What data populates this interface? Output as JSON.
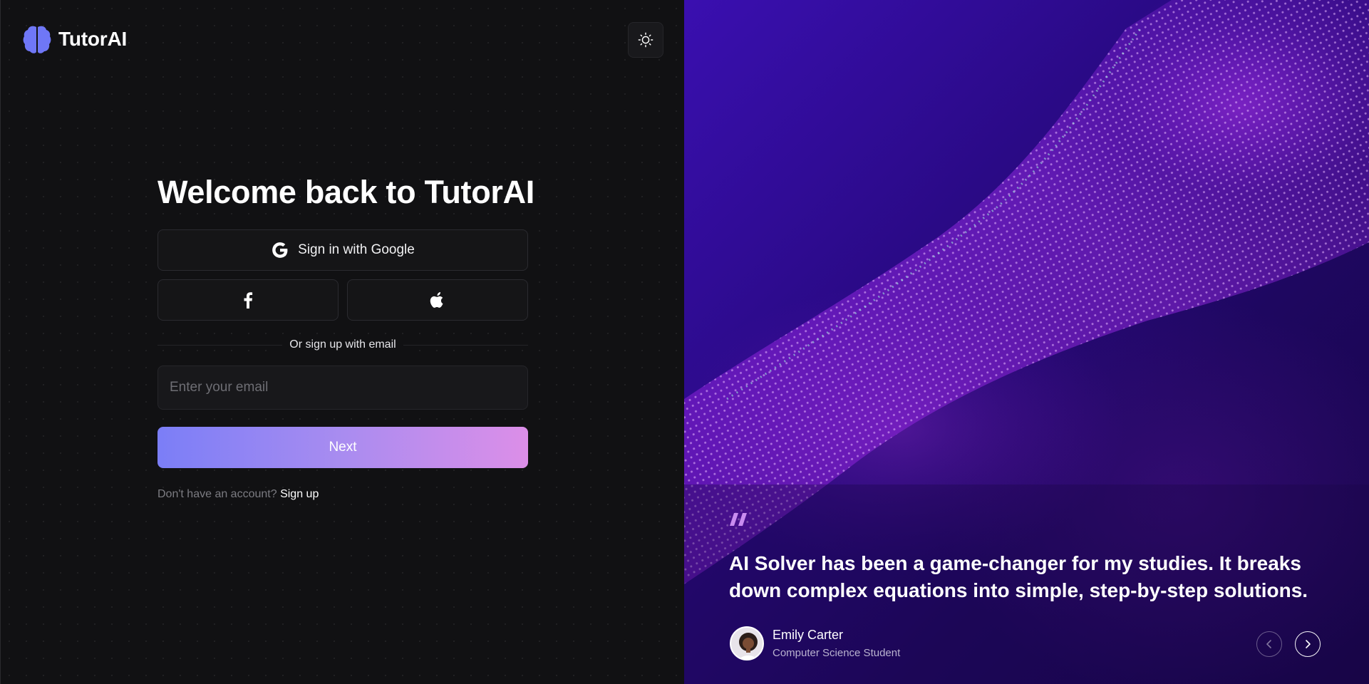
{
  "brand": {
    "name": "TutorAI",
    "logo_icon": "brain-icon"
  },
  "theme_toggle": {
    "icon": "sun-icon"
  },
  "login": {
    "title": "Welcome back to TutorAI",
    "google_label": "Sign in with Google",
    "facebook_icon": "facebook-icon",
    "apple_icon": "apple-icon",
    "divider_text": "Or sign up with email",
    "email_placeholder": "Enter your email",
    "email_value": "",
    "next_label": "Next",
    "no_account_text": "Don't have an account?",
    "signup_link": "Sign up"
  },
  "testimonial": {
    "quote": "AI Solver has been a game-changer for my studies. It breaks down complex equations into simple, step-by-step solutions.",
    "author_name": "Emily Carter",
    "author_role": "Computer Science Student",
    "prev_icon": "chevron-left-icon",
    "next_icon": "chevron-right-icon"
  },
  "colors": {
    "accent_start": "#7b7ef7",
    "accent_end": "#dc8ee8",
    "brand_logo": "#6f77f6",
    "quote_mark": "#c98cf0",
    "panel_bg": "#111113",
    "hero_bg": "#2a0a86"
  }
}
